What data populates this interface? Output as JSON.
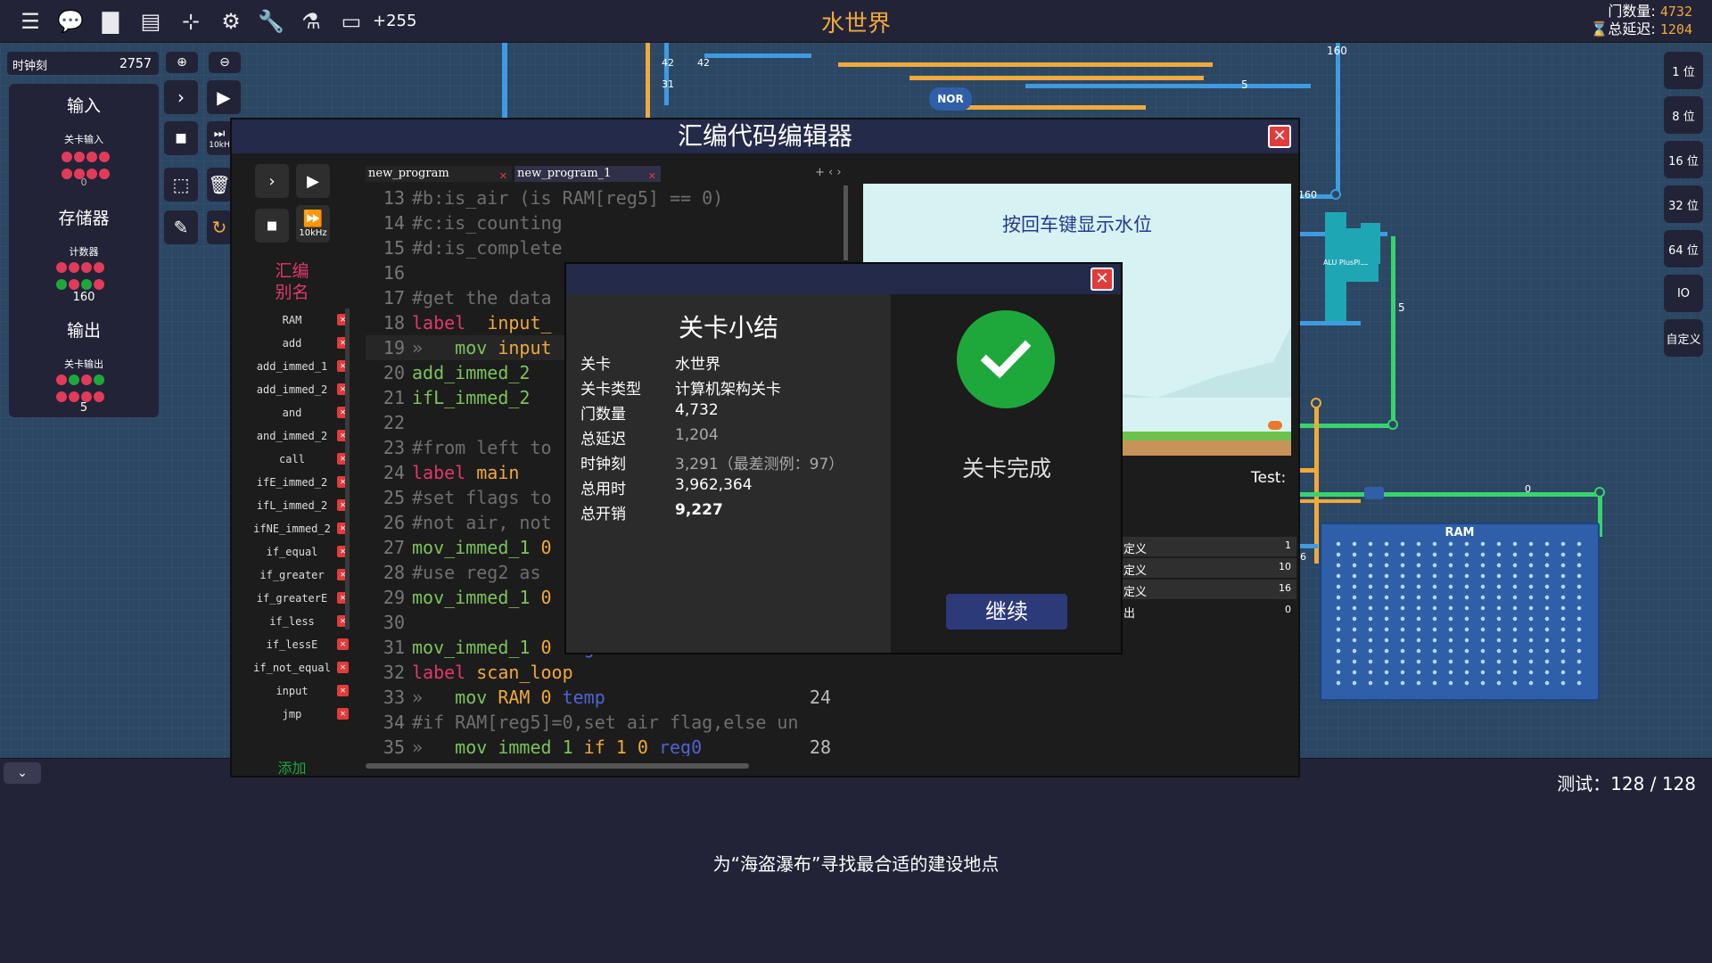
{
  "topbar": {
    "title": "水世界",
    "score": "+255",
    "gate_label": "门数量:",
    "gate_value": "4732",
    "delay_label": "总延迟:",
    "delay_value": "1204",
    "delay_icon": "hourglass-icon"
  },
  "left_panel": {
    "tick_label": "时钟刻",
    "tick_value": "2757",
    "input_heading": "输入",
    "level_input_label": "关卡输入",
    "level_input_value": "0",
    "storage_heading": "存储器",
    "counter_label": "计数器",
    "counter_value": "160",
    "output_heading": "输出",
    "level_output_label": "关卡输出",
    "level_output_value": "5"
  },
  "right_panel": {
    "bits": [
      "1 位",
      "8 位",
      "16 位",
      "32 位",
      "64 位",
      "IO",
      "自定义"
    ]
  },
  "board": {
    "nor_label": "NOR",
    "alu_label": "ALU PlusPlus",
    "ram_label": "RAM",
    "wire_label_160_a": "160",
    "wire_label_160_b": "160",
    "wire_label_5a": "5",
    "wire_label_5b": "5",
    "wire_label_0": "0",
    "wire_label_6": "6",
    "wire_label_42a": "42",
    "wire_label_42b": "42",
    "wire_label_31": "31"
  },
  "editor": {
    "title": "汇编代码编辑器",
    "speed_label": "10kHz",
    "speed_label_outer": "10kH",
    "side_heading_1": "汇编",
    "side_heading_2": "别名",
    "add_label": "添加",
    "aliases": [
      "RAM",
      "add",
      "add_immed_1",
      "add_immed_2",
      "and",
      "and_immed_2",
      "call",
      "ifE_immed_2",
      "ifL_immed_2",
      "ifNE_immed_2",
      "if_equal",
      "if_greater",
      "if_greaterE",
      "if_less",
      "if_lessE",
      "if_not_equal",
      "input",
      "jmp"
    ],
    "tabs": [
      "new_program",
      "new_program_1"
    ],
    "tab_controls": "+ ‹ ›",
    "preview_text": "按回车键显示水位",
    "test_label": "Test:",
    "side_rows": [
      {
        "label": "定义",
        "value": "1"
      },
      {
        "label": "定义",
        "value": "10"
      },
      {
        "label": "定义",
        "value": "16"
      },
      {
        "label": "出",
        "value": "0"
      }
    ]
  },
  "code_lines": [
    {
      "n": "13",
      "parts": [
        [
          "c-comment",
          "#b:is_air (is RAM[reg5] == 0)"
        ]
      ]
    },
    {
      "n": "14",
      "parts": [
        [
          "c-comment",
          "#c:is_counting"
        ]
      ]
    },
    {
      "n": "15",
      "parts": [
        [
          "c-comment",
          "#d:is_complete"
        ]
      ]
    },
    {
      "n": "16",
      "parts": []
    },
    {
      "n": "17",
      "parts": [
        [
          "c-comment",
          "#get the data"
        ]
      ]
    },
    {
      "n": "18",
      "parts": [
        [
          "c-kw",
          "label"
        ],
        [
          "",
          "  "
        ],
        [
          "c-arg",
          "input_"
        ]
      ]
    },
    {
      "n": "19",
      "parts": [
        [
          "c-comment",
          "»   "
        ],
        [
          "c-op",
          "mov"
        ],
        [
          "",
          ""
        ],
        [
          "c-arg",
          " input"
        ]
      ]
    },
    {
      "n": "20",
      "parts": [
        [
          "c-op",
          "add_immed_2"
        ]
      ]
    },
    {
      "n": "21",
      "parts": [
        [
          "c-op",
          "ifL_immed_2"
        ]
      ]
    },
    {
      "n": "22",
      "parts": []
    },
    {
      "n": "23",
      "parts": [
        [
          "c-comment",
          "#from left to"
        ]
      ]
    },
    {
      "n": "24",
      "parts": [
        [
          "c-kw",
          "label"
        ],
        [
          "c-arg",
          " main"
        ]
      ]
    },
    {
      "n": "25",
      "parts": [
        [
          "c-comment",
          "#set flags to"
        ]
      ]
    },
    {
      "n": "26",
      "parts": [
        [
          "c-comment",
          "#not air, not"
        ]
      ]
    },
    {
      "n": "27",
      "parts": [
        [
          "c-op",
          "mov_immed_1"
        ],
        [
          "c-num",
          " 0"
        ]
      ]
    },
    {
      "n": "28",
      "parts": [
        [
          "c-comment",
          "#use reg2 as"
        ]
      ]
    },
    {
      "n": "29",
      "parts": [
        [
          "c-op",
          "mov_immed_1"
        ],
        [
          "c-num",
          " 0"
        ]
      ]
    },
    {
      "n": "30",
      "parts": []
    },
    {
      "n": "31",
      "parts": [
        [
          "c-op",
          "mov_immed_1"
        ],
        [
          "c-num",
          " 0"
        ],
        [
          "c-reg",
          " reg2"
        ]
      ]
    },
    {
      "n": "32",
      "parts": [
        [
          "c-kw",
          "label"
        ],
        [
          "c-arg",
          " scan_loop"
        ]
      ]
    },
    {
      "n": "33",
      "parts": [
        [
          "c-comment",
          "»   "
        ],
        [
          "c-op",
          "mov"
        ],
        [
          "c-arg",
          " RAM"
        ],
        [
          "c-num",
          " 0"
        ],
        [
          "c-reg",
          " temp"
        ]
      ],
      "cnt": "24"
    },
    {
      "n": "34",
      "parts": [
        [
          "c-comment",
          "#if RAM[reg5]=0,set air flag,else un"
        ]
      ]
    },
    {
      "n": "35",
      "parts": [
        [
          "c-comment",
          "»   "
        ],
        [
          "c-op",
          "mov_immed_1"
        ],
        [
          "c-arg",
          " if_1"
        ],
        [
          "c-num",
          " 0"
        ],
        [
          "c-reg",
          " reg0"
        ]
      ],
      "cnt": "28"
    }
  ],
  "summary": {
    "title": "关卡小结",
    "rows": [
      {
        "label": "关卡",
        "value": "水世界"
      },
      {
        "label": "关卡类型",
        "value": "计算机架构关卡"
      },
      {
        "label": "门数量",
        "value": "4,732"
      },
      {
        "label": "总延迟",
        "value": "1,204"
      },
      {
        "label": "时钟刻",
        "value": "3,291（最差测例：97）"
      },
      {
        "label": "总用时",
        "value": "3,962,364"
      },
      {
        "label": "总开销",
        "value": "9,227"
      }
    ],
    "complete_label": "关卡完成",
    "continue_label": "继续"
  },
  "bottom": {
    "test_progress": "测试：128 / 128",
    "caption": "为“海盗瀑布”寻找最合适的建设地点"
  },
  "colors": {
    "accent": "#f0a93a",
    "danger": "#e23b3b",
    "success": "#1ea83c",
    "header_blue": "#232a4a"
  }
}
